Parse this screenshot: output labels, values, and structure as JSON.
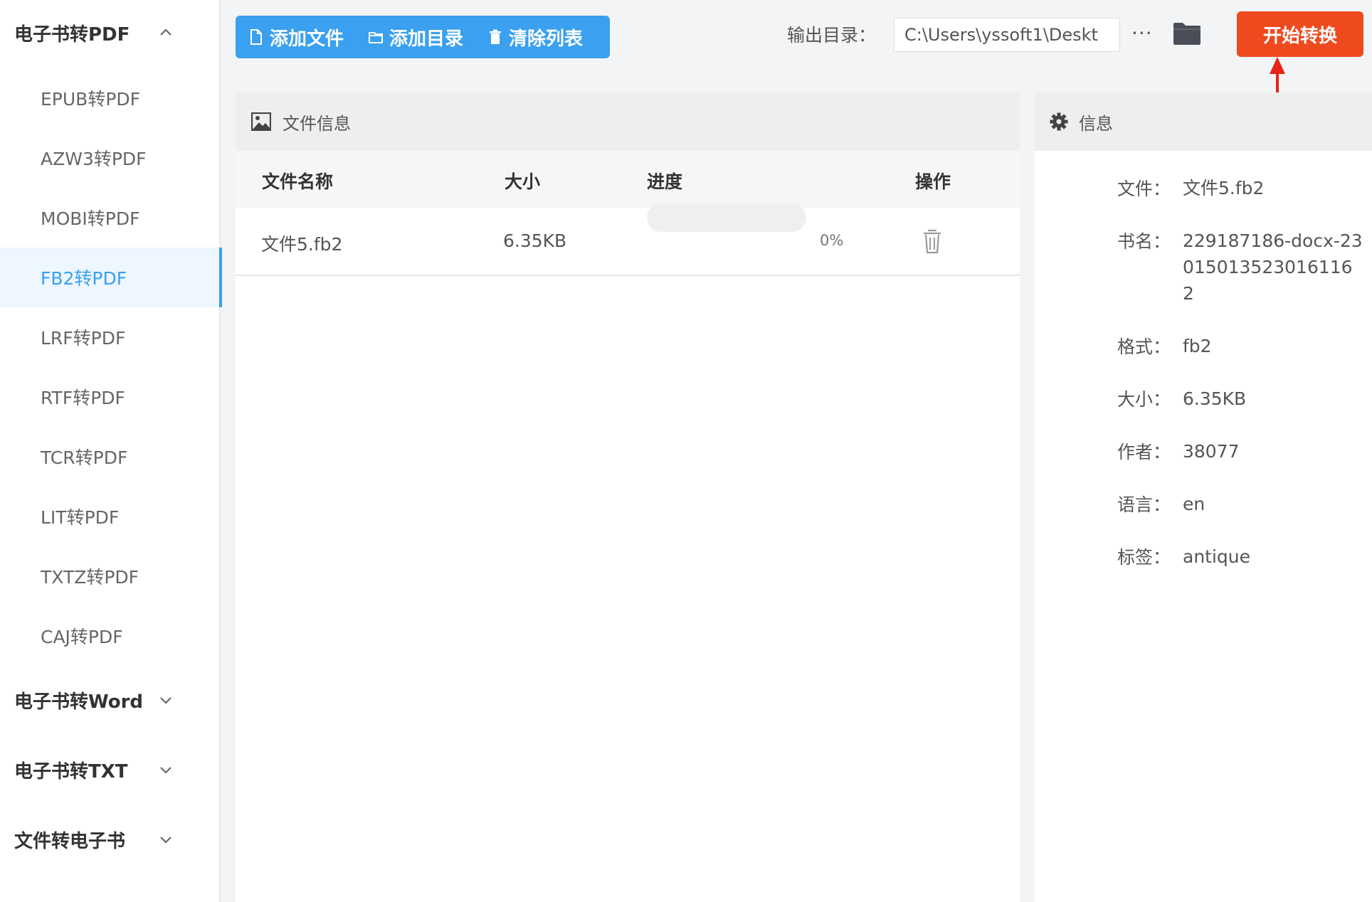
{
  "sidebar": {
    "groups": [
      {
        "label": "电子书转PDF",
        "expanded": true,
        "items": [
          "EPUB转PDF",
          "AZW3转PDF",
          "MOBI转PDF",
          "FB2转PDF",
          "LRF转PDF",
          "RTF转PDF",
          "TCR转PDF",
          "LIT转PDF",
          "TXTZ转PDF",
          "CAJ转PDF"
        ]
      },
      {
        "label": "电子书转Word",
        "expanded": false
      },
      {
        "label": "电子书转TXT",
        "expanded": false
      },
      {
        "label": "文件转电子书",
        "expanded": false
      }
    ],
    "active_item": "FB2转PDF"
  },
  "toolbar": {
    "add_file": "添加文件",
    "add_dir": "添加目录",
    "clear_list": "清除列表",
    "output_label": "输出目录：",
    "output_path": "C:\\Users\\yssoft1\\Deskt",
    "more": "···",
    "start": "开始转换"
  },
  "file_panel": {
    "title": "文件信息",
    "columns": [
      "文件名称",
      "大小",
      "进度",
      "操作"
    ],
    "rows": [
      {
        "name": "文件5.fb2",
        "size": "6.35KB",
        "progress": 0,
        "progress_label": "0%"
      }
    ]
  },
  "info_panel": {
    "title": "信息",
    "fields": [
      {
        "key": "文件：",
        "value": "文件5.fb2"
      },
      {
        "key": "书名：",
        "value": "229187186-docx-23015013523016116 2"
      },
      {
        "key": "格式：",
        "value": "fb2"
      },
      {
        "key": "大小：",
        "value": "6.35KB"
      },
      {
        "key": "作者：",
        "value": "38077"
      },
      {
        "key": "语言：",
        "value": "en"
      },
      {
        "key": "标签：",
        "value": "antique"
      }
    ]
  },
  "colors": {
    "accent": "#3aa0ef",
    "start_button": "#ef4a1e",
    "annotation_arrow": "#e8231a"
  },
  "icons": {
    "add_file": "file-icon",
    "add_dir": "folder-outline-icon",
    "clear_list": "trash-icon",
    "folder": "folder-icon",
    "file_panel": "image-icon",
    "info_panel": "gear-icon",
    "row_action": "trash-icon"
  }
}
